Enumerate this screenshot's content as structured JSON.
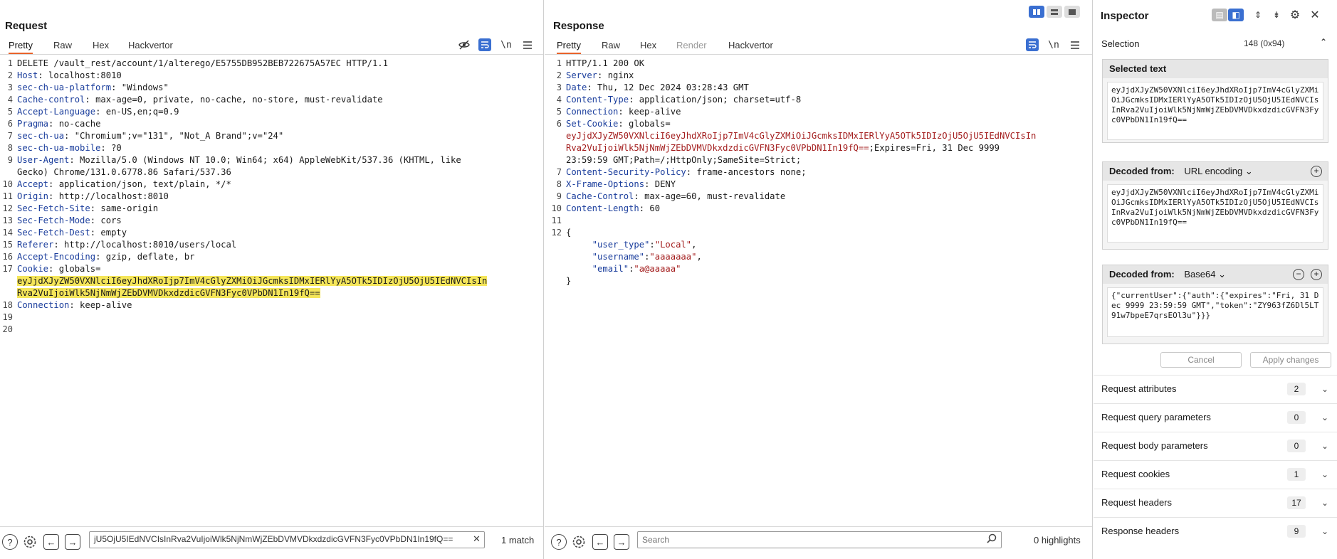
{
  "request": {
    "title": "Request",
    "tabs": [
      "Pretty",
      "Raw",
      "Hex",
      "Hackvertor"
    ],
    "newline_label": "\\n",
    "lines": [
      {
        "n": "1",
        "parts": [
          [
            "v",
            "DELETE /vault_rest/account/1/alterego/E5755DB952BEB722675A57EC HTTP/1.1"
          ]
        ]
      },
      {
        "n": "2",
        "parts": [
          [
            "k",
            "Host"
          ],
          [
            "v",
            ": localhost:8010"
          ]
        ]
      },
      {
        "n": "3",
        "parts": [
          [
            "k",
            "sec-ch-ua-platform"
          ],
          [
            "v",
            ": \"Windows\""
          ]
        ]
      },
      {
        "n": "4",
        "parts": [
          [
            "k",
            "Cache-control"
          ],
          [
            "v",
            ": max-age=0, private, no-cache, no-store, must-revalidate"
          ]
        ]
      },
      {
        "n": "5",
        "parts": [
          [
            "k",
            "Accept-Language"
          ],
          [
            "v",
            ": en-US,en;q=0.9"
          ]
        ]
      },
      {
        "n": "6",
        "parts": [
          [
            "k",
            "Pragma"
          ],
          [
            "v",
            ": no-cache"
          ]
        ]
      },
      {
        "n": "7",
        "parts": [
          [
            "k",
            "sec-ch-ua"
          ],
          [
            "v",
            ": \"Chromium\";v=\"131\", \"Not_A Brand\";v=\"24\""
          ]
        ]
      },
      {
        "n": "8",
        "parts": [
          [
            "k",
            "sec-ch-ua-mobile"
          ],
          [
            "v",
            ": ?0"
          ]
        ]
      },
      {
        "n": "9",
        "parts": [
          [
            "k",
            "User-Agent"
          ],
          [
            "v",
            ": Mozilla/5.0 (Windows NT 10.0; Win64; x64) AppleWebKit/537.36 (KHTML, like"
          ]
        ]
      },
      {
        "n": "",
        "parts": [
          [
            "v",
            "Gecko) Chrome/131.0.6778.86 Safari/537.36"
          ]
        ]
      },
      {
        "n": "10",
        "parts": [
          [
            "k",
            "Accept"
          ],
          [
            "v",
            ": application/json, text/plain, */*"
          ]
        ]
      },
      {
        "n": "11",
        "parts": [
          [
            "k",
            "Origin"
          ],
          [
            "v",
            ": http://localhost:8010"
          ]
        ]
      },
      {
        "n": "12",
        "parts": [
          [
            "k",
            "Sec-Fetch-Site"
          ],
          [
            "v",
            ": same-origin"
          ]
        ]
      },
      {
        "n": "13",
        "parts": [
          [
            "k",
            "Sec-Fetch-Mode"
          ],
          [
            "v",
            ": cors"
          ]
        ]
      },
      {
        "n": "14",
        "parts": [
          [
            "k",
            "Sec-Fetch-Dest"
          ],
          [
            "v",
            ": empty"
          ]
        ]
      },
      {
        "n": "15",
        "parts": [
          [
            "k",
            "Referer"
          ],
          [
            "v",
            ": http://localhost:8010/users/local"
          ]
        ]
      },
      {
        "n": "16",
        "parts": [
          [
            "k",
            "Accept-Encoding"
          ],
          [
            "v",
            ": gzip, deflate, br"
          ]
        ]
      },
      {
        "n": "17",
        "parts": [
          [
            "k",
            "Cookie"
          ],
          [
            "v",
            ": globals="
          ]
        ]
      },
      {
        "n": "",
        "parts": [
          [
            "hl",
            "eyJjdXJyZW50VXNlciI6eyJhdXRoIjp7ImV4cGlyZXMiOiJGcmksIDMxIERlYyA5OTk5IDIzOjU5OjU5IEdNVCIsIn"
          ]
        ]
      },
      {
        "n": "",
        "parts": [
          [
            "hl",
            "Rva2VuIjoiWlk5NjNmWjZEbDVMVDkxdzdicGVFN3Fyc0VPbDN1In19fQ=="
          ]
        ]
      },
      {
        "n": "18",
        "parts": [
          [
            "k",
            "Connection"
          ],
          [
            "v",
            ": keep-alive"
          ]
        ]
      },
      {
        "n": "19",
        "parts": []
      },
      {
        "n": "20",
        "parts": []
      }
    ],
    "search_value": "jU5OjU5IEdNVCIsInRva2VuIjoiWlk5NjNmWjZEbDVMVDkxdzdicGVFN3Fyc0VPbDN1In19fQ==",
    "match_label": "1 match"
  },
  "response": {
    "title": "Response",
    "tabs": [
      "Pretty",
      "Raw",
      "Hex",
      "Render",
      "Hackvertor"
    ],
    "newline_label": "\\n",
    "lines": [
      {
        "n": "1",
        "parts": [
          [
            "v",
            "HTTP/1.1 200 OK"
          ]
        ]
      },
      {
        "n": "2",
        "parts": [
          [
            "k",
            "Server"
          ],
          [
            "v",
            ": nginx"
          ]
        ]
      },
      {
        "n": "3",
        "parts": [
          [
            "k",
            "Date"
          ],
          [
            "v",
            ": Thu, 12 Dec 2024 03:28:43 GMT"
          ]
        ]
      },
      {
        "n": "4",
        "parts": [
          [
            "k",
            "Content-Type"
          ],
          [
            "v",
            ": application/json; charset=utf-8"
          ]
        ]
      },
      {
        "n": "5",
        "parts": [
          [
            "k",
            "Connection"
          ],
          [
            "v",
            ": keep-alive"
          ]
        ]
      },
      {
        "n": "6",
        "parts": [
          [
            "k",
            "Set-Cookie"
          ],
          [
            "v",
            ": globals="
          ]
        ]
      },
      {
        "n": "",
        "parts": [
          [
            "red",
            "eyJjdXJyZW50VXNlciI6eyJhdXRoIjp7ImV4cGlyZXMiOiJGcmksIDMxIERlYyA5OTk5IDIzOjU5OjU5IEdNVCIsIn"
          ]
        ]
      },
      {
        "n": "",
        "parts": [
          [
            "red",
            "Rva2VuIjoiWlk5NjNmWjZEbDVMVDkxdzdicGVFN3Fyc0VPbDN1In19fQ=="
          ],
          [
            "v",
            ";Expires=Fri, 31 Dec 9999"
          ]
        ]
      },
      {
        "n": "",
        "parts": [
          [
            "v",
            "23:59:59 GMT;Path=/;HttpOnly;SameSite=Strict;"
          ]
        ]
      },
      {
        "n": "7",
        "parts": [
          [
            "k",
            "Content-Security-Policy"
          ],
          [
            "v",
            ": frame-ancestors none;"
          ]
        ]
      },
      {
        "n": "8",
        "parts": [
          [
            "k",
            "X-Frame-Options"
          ],
          [
            "v",
            ": DENY"
          ]
        ]
      },
      {
        "n": "9",
        "parts": [
          [
            "k",
            "Cache-Control"
          ],
          [
            "v",
            ": max-age=60, must-revalidate"
          ]
        ]
      },
      {
        "n": "10",
        "parts": [
          [
            "k",
            "Content-Length"
          ],
          [
            "v",
            ": 60"
          ]
        ]
      },
      {
        "n": "11",
        "parts": []
      },
      {
        "n": "12",
        "parts": [
          [
            "v",
            "{"
          ]
        ]
      },
      {
        "n": "",
        "parts": [
          [
            "v",
            "     "
          ],
          [
            "k",
            "\"user_type\""
          ],
          [
            "v",
            ":"
          ],
          [
            "red",
            "\"Local\""
          ],
          [
            "v",
            ","
          ]
        ]
      },
      {
        "n": "",
        "parts": [
          [
            "v",
            "     "
          ],
          [
            "k",
            "\"username\""
          ],
          [
            "v",
            ":"
          ],
          [
            "red",
            "\"aaaaaaa\""
          ],
          [
            "v",
            ","
          ]
        ]
      },
      {
        "n": "",
        "parts": [
          [
            "v",
            "     "
          ],
          [
            "k",
            "\"email\""
          ],
          [
            "v",
            ":"
          ],
          [
            "red",
            "\"a@aaaaa\""
          ]
        ]
      },
      {
        "n": "",
        "parts": [
          [
            "v",
            "}"
          ]
        ]
      }
    ],
    "search_placeholder": "Search",
    "match_label": "0 highlights"
  },
  "inspector": {
    "title": "Inspector",
    "selection_label": "Selection",
    "selection_info": "148 (0x94)",
    "selected_text_label": "Selected text",
    "selected_text": "eyJjdXJyZW50VXNlciI6eyJhdXRoIjp7ImV4cGlyZXMiOiJGcmksIDMxIERlYyA5OTk5IDIzOjU5OjU5IEdNVCIsInRva2VuIjoiWlk5NjNmWjZEbDVMVDkxdzdicGVFN3Fyc0VPbDN1In19fQ==",
    "decoded1_label": "Decoded from:",
    "decoded1_type": "URL encoding",
    "decoded1_text": "eyJjdXJyZW50VXNlciI6eyJhdXRoIjp7ImV4cGlyZXMiOiJGcmksIDMxIERlYyA5OTk5IDIzOjU5OjU5IEdNVCIsInRva2VuIjoiWlk5NjNmWjZEbDVMVDkxdzdicGVFN3Fyc0VPbDN1In19fQ==",
    "decoded2_label": "Decoded from:",
    "decoded2_type": "Base64",
    "decoded2_text": "{\"currentUser\":{\"auth\":{\"expires\":\"Fri, 31 Dec 9999 23:59:59 GMT\",\"token\":\"ZY963fZ6Dl5LT91w7bpeE7qrsEOl3u\"}}}",
    "cancel_label": "Cancel",
    "apply_label": "Apply changes",
    "sections": [
      {
        "label": "Request attributes",
        "count": "2"
      },
      {
        "label": "Request query parameters",
        "count": "0"
      },
      {
        "label": "Request body parameters",
        "count": "0"
      },
      {
        "label": "Request cookies",
        "count": "1"
      },
      {
        "label": "Request headers",
        "count": "17"
      },
      {
        "label": "Response headers",
        "count": "9"
      }
    ]
  },
  "colors": {
    "accent": "#e8632a",
    "blue": "#3a6fd1",
    "header_key": "#1a3d9c",
    "value_red": "#a31d1d",
    "highlight": "#f5e65a"
  }
}
